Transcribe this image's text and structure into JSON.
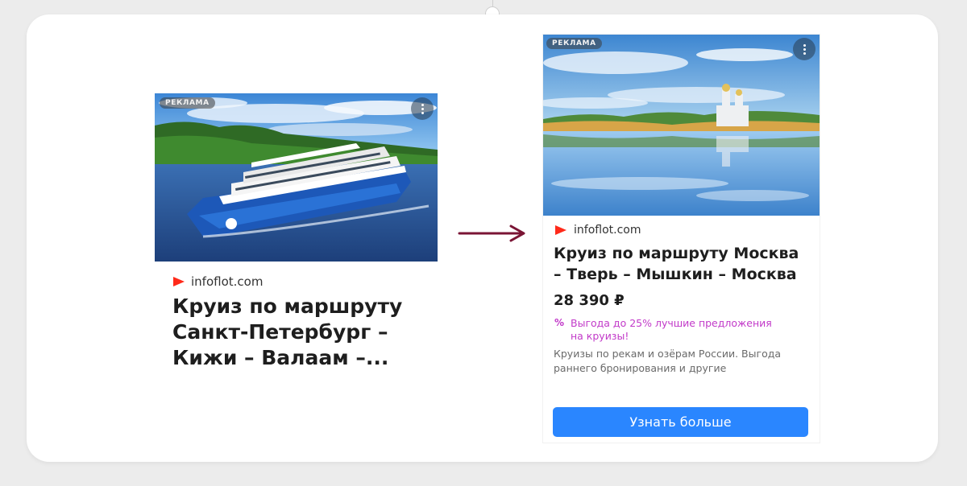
{
  "ad_before": {
    "badge": "РЕКЛАМА",
    "domain": "infoflot.com",
    "title": "Круиз по маршруту Санкт-Петербург – Кижи – Валаам –..."
  },
  "ad_after": {
    "badge": "РЕКЛАМА",
    "domain": "infoflot.com",
    "title": "Круиз по маршруту Москва – Тверь – Мышкин – Москва",
    "price": "28 390 ₽",
    "promo_icon": "%",
    "promo_text": "Выгода до 25% лучшие предложения на круизы!",
    "description": "Круизы по рекам и озёрам России. Выгода раннего бронирования и другие",
    "cta_label": "Узнать больше"
  },
  "colors": {
    "brand_logo": "#ff2a1a",
    "promo": "#c23ac9",
    "cta": "#2a86ff",
    "arrow": "#7a1535"
  },
  "icons": {
    "logo": "play-triangle-logo-icon",
    "more": "vertical-dots-more-icon",
    "arrow": "right-arrow-icon",
    "promo": "percent-icon"
  }
}
